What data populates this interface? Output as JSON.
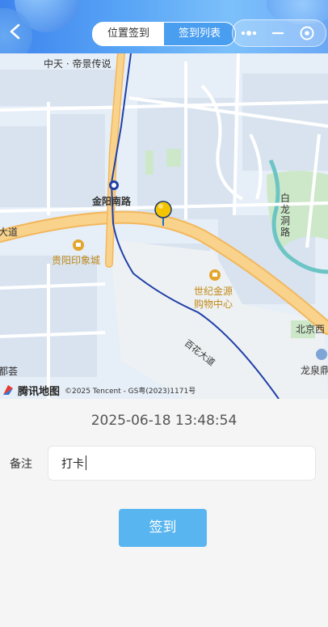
{
  "header": {
    "tabs": [
      {
        "label": "位置签到",
        "active": false
      },
      {
        "label": "签到列表",
        "active": true
      }
    ],
    "icons": {
      "back": "chevron-left-icon",
      "more": "more-dots-icon",
      "minimize": "minimize-icon",
      "close": "target-circle-icon"
    }
  },
  "map": {
    "labels": {
      "zhongtian": "中天 · 帝景传说",
      "station": "金阳南路",
      "yinxiang": "贵阳印象城",
      "shiji1": "世纪金源",
      "shiji2": "购物中心",
      "bailong": "白龙洞路",
      "dadao_left": "大道",
      "baihua": "百花大道",
      "beijing": "北京西",
      "longquan": "龙泉鼎",
      "dusui": "都荟"
    },
    "watermark": {
      "brand": "腾讯地图",
      "copyright": "©2025 Tencent - GS粤(2023)1171号"
    },
    "colors": {
      "road_major": "#f7c978",
      "metro": "#2040a8",
      "water": "#6cc5c4",
      "green": "#cde8c9",
      "pin": "#f5c400"
    }
  },
  "form": {
    "datetime": "2025-06-18 13:48:54",
    "note_label": "备注",
    "note_value": "打卡",
    "submit_label": "签到"
  },
  "colors": {
    "accent": "#4a9ef0",
    "button": "#58b5f0"
  }
}
